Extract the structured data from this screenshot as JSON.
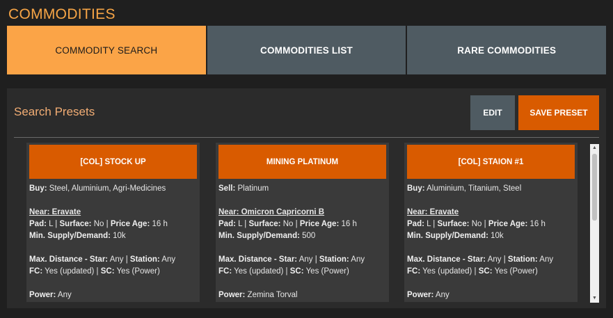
{
  "page": {
    "title": "COMMODITIES"
  },
  "tabs": [
    {
      "label": "COMMODITY SEARCH",
      "active": true
    },
    {
      "label": "COMMODITIES LIST",
      "active": false
    },
    {
      "label": "RARE COMMODITIES",
      "active": false
    }
  ],
  "panel": {
    "title": "Search Presets",
    "edit_label": "EDIT",
    "save_label": "SAVE PRESET"
  },
  "presets": [
    {
      "name": "[COL] STOCK UP",
      "mode": "Buy:",
      "commodities": "Steel, Aluminium, Agri-Medicines",
      "near": "Near: Eravate",
      "pad_label": "Pad:",
      "pad": "L",
      "surface_label": "Surface:",
      "surface": "No",
      "price_age_label": "Price Age:",
      "price_age": "16 h",
      "min_supply_label": "Min. Supply/Demand:",
      "min_supply": "10k",
      "max_dist_label": "Max. Distance - Star:",
      "max_dist": "Any",
      "station_label": "Station:",
      "station": "Any",
      "fc_label": "FC:",
      "fc": "Yes (updated)",
      "sc_label": "SC:",
      "sc": "Yes (Power)",
      "power_label": "Power:",
      "power": "Any"
    },
    {
      "name": "MINING PLATINUM",
      "mode": "Sell:",
      "commodities": "Platinum",
      "near": "Near: Omicron Capricorni B",
      "pad_label": "Pad:",
      "pad": "L",
      "surface_label": "Surface:",
      "surface": "No",
      "price_age_label": "Price Age:",
      "price_age": "16 h",
      "min_supply_label": "Min. Supply/Demand:",
      "min_supply": "500",
      "max_dist_label": "Max. Distance - Star:",
      "max_dist": "Any",
      "station_label": "Station:",
      "station": "Any",
      "fc_label": "FC:",
      "fc": "Yes (updated)",
      "sc_label": "SC:",
      "sc": "Yes (Power)",
      "power_label": "Power:",
      "power": "Zemina Torval"
    },
    {
      "name": "[COL] STAION #1",
      "mode": "Buy:",
      "commodities": "Aluminium, Titanium, Steel",
      "near": "Near: Eravate",
      "pad_label": "Pad:",
      "pad": "L",
      "surface_label": "Surface:",
      "surface": "No",
      "price_age_label": "Price Age:",
      "price_age": "16 h",
      "min_supply_label": "Min. Supply/Demand:",
      "min_supply": "10k",
      "max_dist_label": "Max. Distance - Star:",
      "max_dist": "Any",
      "station_label": "Station:",
      "station": "Any",
      "fc_label": "FC:",
      "fc": "Yes (updated)",
      "sc_label": "SC:",
      "sc": "Yes (Power)",
      "power_label": "Power:",
      "power": "Any"
    }
  ],
  "scrollbar": {
    "up_icon": "▲",
    "down_icon": "▼"
  },
  "colors": {
    "accent": "#fba447",
    "button": "#d95b00",
    "tab": "#4f5b62",
    "background": "#1f1f1f",
    "panel": "#2b2b2b",
    "card": "#3a3a3a"
  }
}
